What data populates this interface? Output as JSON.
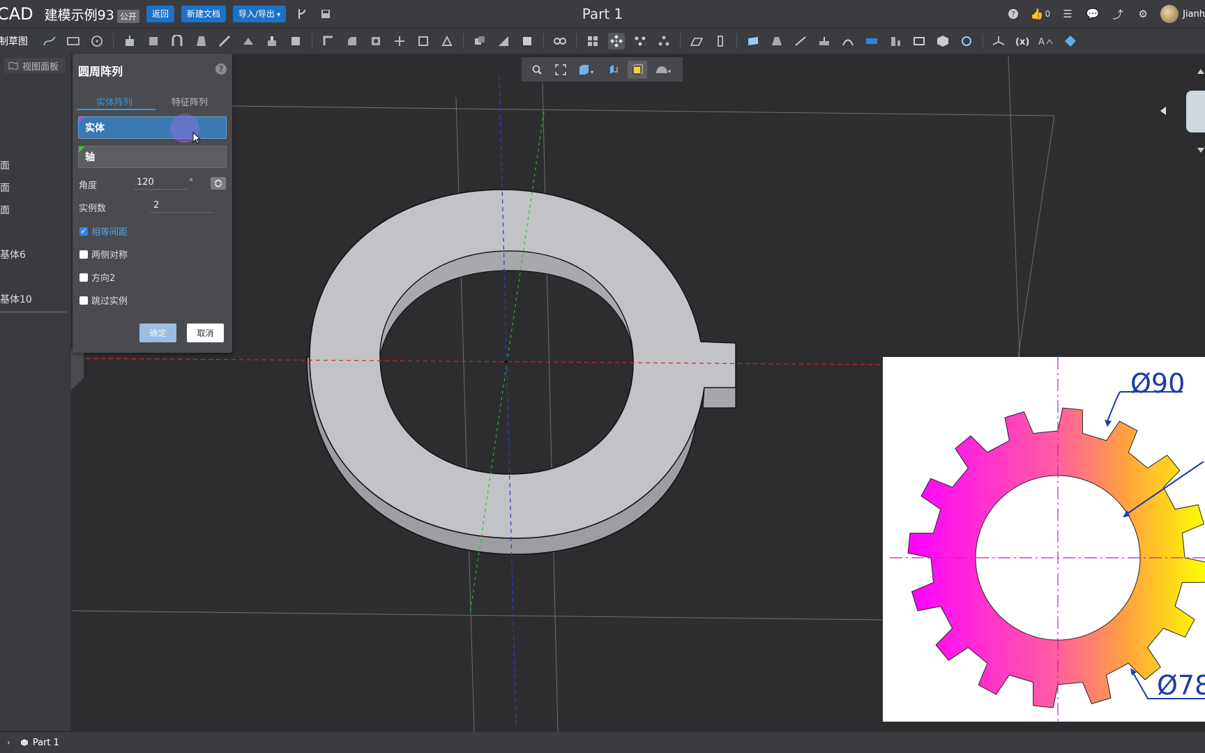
{
  "topbar": {
    "brand": "CAD",
    "doc_title": "建模示例93",
    "public_badge": "公开",
    "back_btn": "返回",
    "new_doc_btn": "新建文档",
    "import_export_btn": "导入/导出",
    "part_title": "Part 1",
    "likes": "0",
    "user_name": "Jianh"
  },
  "toolbar": {
    "sketch_label": "制草图"
  },
  "left_panel": {
    "view_panel_btn": "视图面板",
    "items": [
      "面",
      "面",
      "面",
      "基体6",
      "基体10"
    ]
  },
  "dialog": {
    "title": "圆周阵列",
    "tabs": [
      "实体阵列",
      "特征阵列"
    ],
    "entity_field": "实体",
    "axis_field": "轴",
    "angle_label": "角度",
    "angle_value": "120",
    "angle_unit": "°",
    "instances_label": "实例数",
    "instances_value": "2",
    "checkboxes": [
      {
        "label": "相等间距",
        "checked": true
      },
      {
        "label": "两侧对称",
        "checked": false
      },
      {
        "label": "方向2",
        "checked": false
      },
      {
        "label": "跳过实例",
        "checked": false
      }
    ],
    "ok_btn": "确定",
    "cancel_btn": "取消"
  },
  "overlay": {
    "dim_outer": "Ø90",
    "dim_inner": "Ø78"
  },
  "statusbar": {
    "part": "Part 1"
  },
  "colors": {
    "accent": "#1a73c8",
    "active_tab": "#2d9bef",
    "dim_text": "#1c3aa8"
  }
}
